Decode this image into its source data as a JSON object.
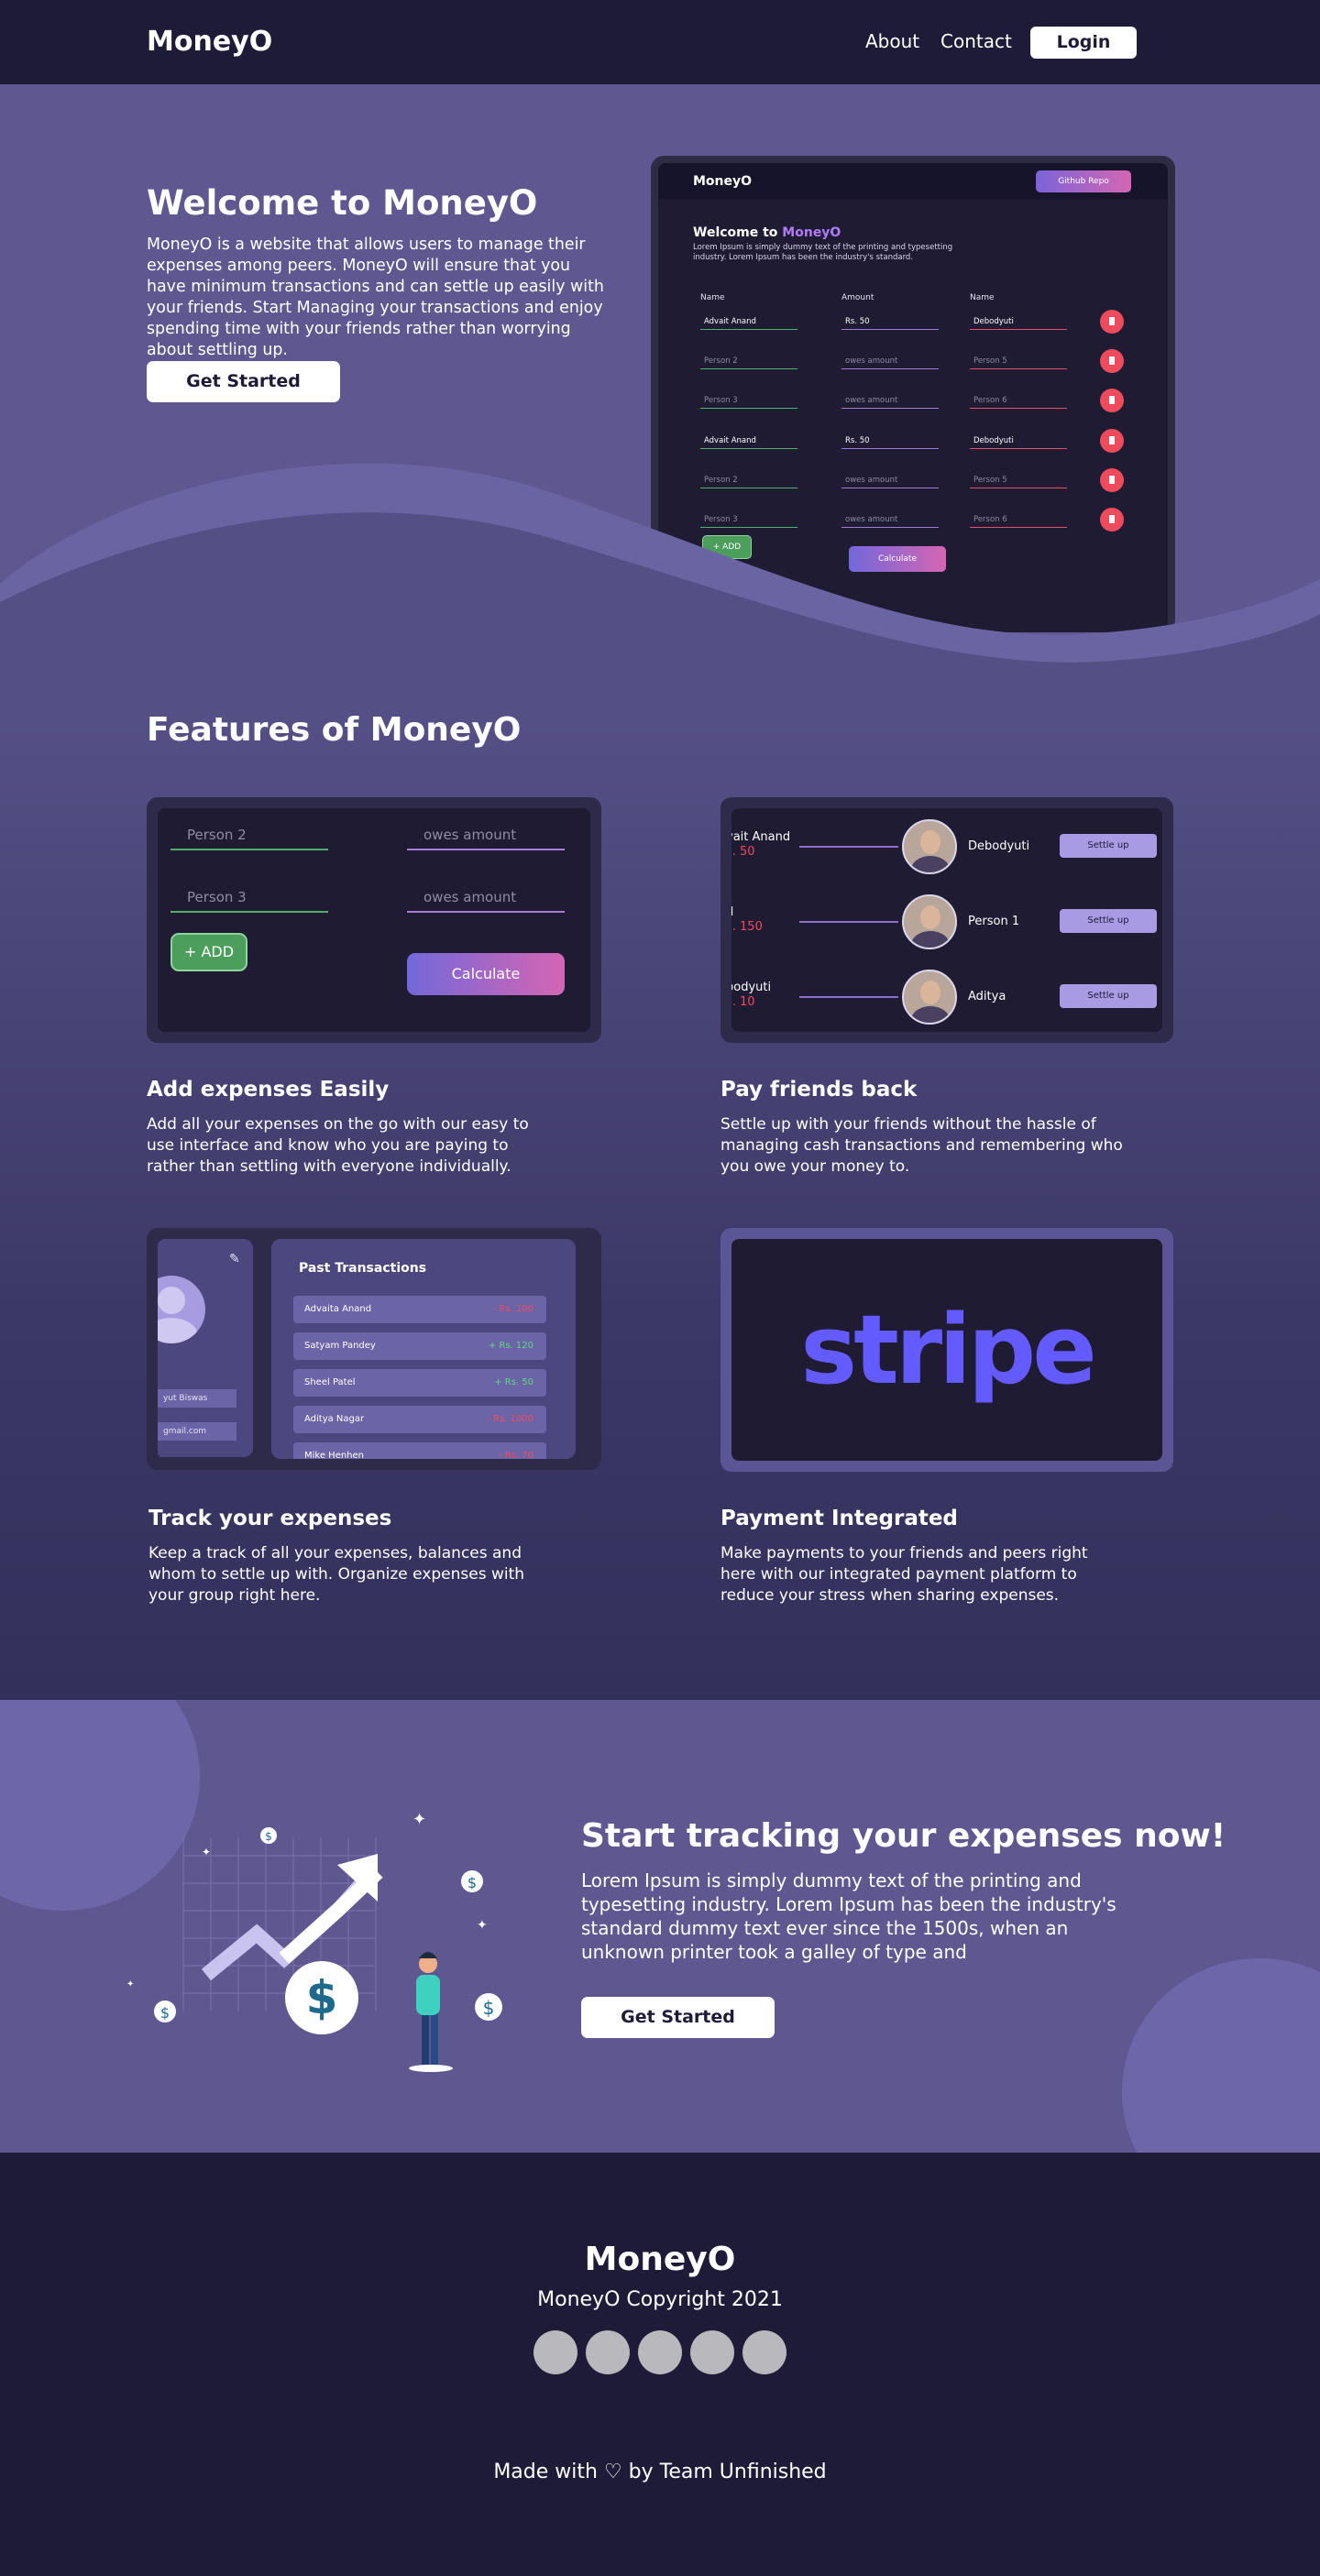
{
  "nav": {
    "brand": "MoneyO",
    "links": [
      "About",
      "Contact"
    ],
    "login_label": "Login"
  },
  "hero": {
    "title": "Welcome to MoneyO",
    "text": "MoneyO is a website that allows users to manage their expenses among peers. MoneyO will ensure that you have minimum transactions and can settle up easily with your friends. Start Managing your transactions and enjoy spending time with your friends rather than worrying about settling up.",
    "button": "Get Started",
    "mockup": {
      "brand": "MoneyO",
      "github_button": "Github Repo",
      "welcome_prefix": "Welcome to ",
      "welcome_accent": "MoneyO",
      "lorem": "Lorem Ipsum is simply dummy text of the printing and typesetting industry. Lorem Ipsum has been the industry's standard.",
      "columns": [
        "Name",
        "Amount",
        "Name"
      ],
      "rows": [
        [
          "Advait Anand",
          "Rs. 50",
          "Debodyuti"
        ],
        [
          "Person 2",
          "owes amount",
          "Person 5"
        ],
        [
          "Person 3",
          "owes amount",
          "Person 6"
        ],
        [
          "Advait Anand",
          "Rs. 50",
          "Debodyuti"
        ],
        [
          "Person 2",
          "owes amount",
          "Person 5"
        ],
        [
          "Person 3",
          "owes amount",
          "Person 6"
        ]
      ],
      "add_button": "+ ADD",
      "calculate_button": "Calculate"
    }
  },
  "features": {
    "title": "Features of MoneyO",
    "items": [
      {
        "heading": "Add expenses Easily",
        "text": "Add all your expenses on the go with our easy to use interface and know who you are paying to rather than settling with everyone individually."
      },
      {
        "heading": "Pay friends back",
        "text": "Settle up with your friends without the hassle of managing cash transactions and remembering who you owe your money to."
      },
      {
        "heading": "Track your expenses",
        "text": "Keep a track of all your expenses, balances and whom to settle up with. Organize expenses with your group right here."
      },
      {
        "heading": "Payment Integrated",
        "text": "Make payments to your friends and peers right here with our integrated payment platform to reduce your stress when sharing expenses."
      }
    ],
    "card1": {
      "fields": [
        "Person 2",
        "owes amount",
        "Person 3",
        "owes amount"
      ],
      "add_button": "+ ADD",
      "calculate_button": "Calculate"
    },
    "card2": {
      "rows": [
        {
          "from": "vait Anand",
          "amount": "s. 50",
          "to": "Debodyuti",
          "button": "Settle up"
        },
        {
          "from": "d",
          "amount": "s. 150",
          "to": "Person 1",
          "button": "Settle up"
        },
        {
          "from": "bodyuti",
          "amount": "s. 10",
          "to": "Aditya",
          "button": "Settle up"
        }
      ]
    },
    "card3": {
      "side_tags": [
        "yut Biswas",
        "gmail.com"
      ],
      "title": "Past Transactions",
      "transactions": [
        {
          "name": "Advaita Anand",
          "value": "- Rs. 100",
          "color": "#f04a5e"
        },
        {
          "name": "Satyam Pandey",
          "value": "+ Rs. 120",
          "color": "#62d487"
        },
        {
          "name": "Sheel Patel",
          "value": "+ Rs. 50",
          "color": "#62d487"
        },
        {
          "name": "Aditya Nagar",
          "value": "- Rs. 1000",
          "color": "#f04a5e"
        },
        {
          "name": "Mike Henhen",
          "value": "- Rs. 70",
          "color": "#f04a5e"
        }
      ]
    },
    "card4": {
      "logo_text": "stripe",
      "color": "#635bff"
    }
  },
  "cta": {
    "title": "Start tracking your expenses now!",
    "text": "Lorem Ipsum is simply dummy text of the printing and typesetting industry. Lorem Ipsum has been the industry's standard dummy text ever since the 1500s, when an unknown printer took a galley of type and",
    "button": "Get Started"
  },
  "footer": {
    "brand": "MoneyO",
    "copyright": "MoneyO Copyright 2021",
    "social_icons": [
      "social-icon-1",
      "social-icon-2",
      "social-icon-3",
      "social-icon-4",
      "social-icon-5"
    ],
    "made_with": "Made with ♡ by Team Unfinished"
  },
  "colors": {
    "background": "#1e1b38",
    "hero": "#5f5890",
    "accent": "#7368d9",
    "delete": "#ee4b5c",
    "add": "#4c9e5c"
  }
}
